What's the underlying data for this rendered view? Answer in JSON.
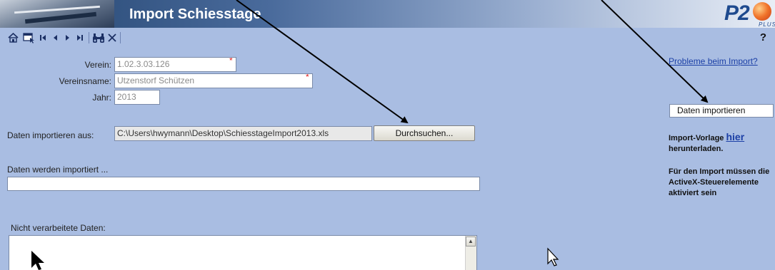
{
  "header": {
    "title": "Import Schiesstage",
    "logo_text": "P2",
    "logo_sub": "PLUS"
  },
  "toolbar": {
    "help_label": "?",
    "icons": [
      "home-icon",
      "window-pointer-icon",
      "first-record-icon",
      "previous-record-icon",
      "next-record-icon",
      "last-record-icon",
      "binoculars-search-icon",
      "close-icon"
    ]
  },
  "form": {
    "verein": {
      "label": "Verein:",
      "value": "1.02.3.03.126",
      "required_mark": "*"
    },
    "vereinsname": {
      "label": "Vereinsname:",
      "value": "Utzenstorf  Schützen",
      "required_mark": "*"
    },
    "jahr": {
      "label": "Jahr:",
      "value": "2013"
    },
    "import_from": {
      "label": "Daten importieren aus:",
      "value": "C:\\Users\\hwymann\\Desktop\\SchiesstageImport2013.xls",
      "browse_label": "Durchsuchen..."
    },
    "progress_label": "Daten werden importiert ...",
    "unprocessed_label": "Nicht verarbeitete Daten:"
  },
  "sidebar": {
    "problem_link": "Probleme beim Import?",
    "import_button": "Daten importieren",
    "template_prefix": "Import-Vorlage ",
    "template_link": "hier",
    "template_suffix": "herunterladen.",
    "activex_note": "Für den Import müssen die ActiveX-Steuerelemente aktiviert sein"
  }
}
